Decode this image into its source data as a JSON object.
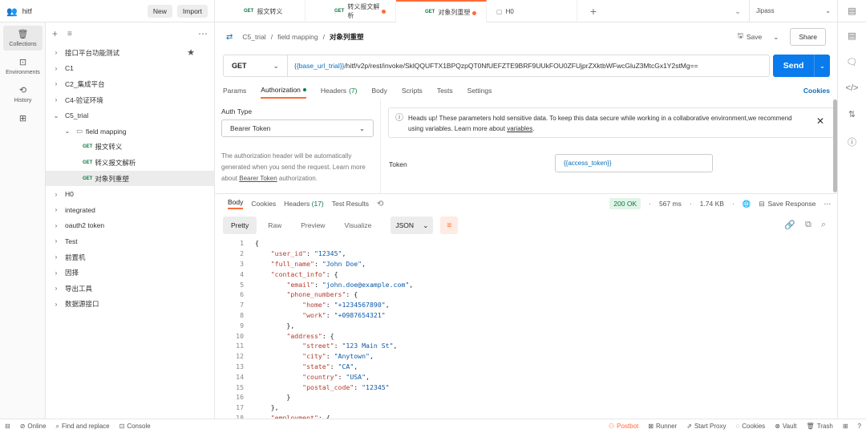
{
  "workspace": {
    "name": "hitf",
    "new": "New",
    "import": "Import"
  },
  "tabs": [
    {
      "method": "GET",
      "label": "报文转义",
      "dirty": false
    },
    {
      "method": "GET",
      "label": "转义报文解析",
      "dirty": true
    },
    {
      "method": "GET",
      "label": "对象列重塑",
      "dirty": true,
      "active": true
    },
    {
      "method": "",
      "label": "H0",
      "dirty": false
    }
  ],
  "environment": "Jipass",
  "rail": [
    {
      "label": "Collections",
      "icon": "collections-icon",
      "active": true
    },
    {
      "label": "Environments",
      "icon": "environments-icon"
    },
    {
      "label": "History",
      "icon": "history-icon"
    },
    {
      "label": "",
      "icon": "apps-icon"
    }
  ],
  "tree": [
    {
      "label": "接口平台功能测试",
      "depth": 0,
      "chev": "›",
      "star": true
    },
    {
      "label": "C1",
      "depth": 0,
      "chev": "›"
    },
    {
      "label": "C2_集成平台",
      "depth": 0,
      "chev": "›"
    },
    {
      "label": "C4-验证环境",
      "depth": 0,
      "chev": "›"
    },
    {
      "label": "C5_trial",
      "depth": 0,
      "chev": "⌄"
    },
    {
      "label": "field mapping",
      "depth": 1,
      "chev": "⌄",
      "folder": true
    },
    {
      "label": "报文转义",
      "depth": 2,
      "method": "GET"
    },
    {
      "label": "转义报文解析",
      "depth": 2,
      "method": "GET"
    },
    {
      "label": "对象列重塑",
      "depth": 2,
      "method": "GET",
      "selected": true
    },
    {
      "label": "H0",
      "depth": 0,
      "chev": "›"
    },
    {
      "label": "integrated",
      "depth": 0,
      "chev": "›"
    },
    {
      "label": "oauth2 token",
      "depth": 0,
      "chev": "›"
    },
    {
      "label": "Test",
      "depth": 0,
      "chev": "›"
    },
    {
      "label": "前置机",
      "depth": 0,
      "chev": "›"
    },
    {
      "label": "因择",
      "depth": 0,
      "chev": "›"
    },
    {
      "label": "导出工具",
      "depth": 0,
      "chev": "›"
    },
    {
      "label": "数据源接口",
      "depth": 0,
      "chev": "›"
    }
  ],
  "breadcrumb": {
    "p1": "C5_trial",
    "p2": "field mapping",
    "current": "对象列重塑",
    "save": "Save",
    "share": "Share"
  },
  "request": {
    "method": "GET",
    "url_var": "{{base_url_trial}}",
    "url_rest": " /hitf/v2p/rest/invoke/SklQQUFTX1BPQzpQT0NfUEFZTE9BRF9UUkFOU0ZFUjprZXktbWFwcGluZ3MtcGx1Y2stMg==",
    "send": "Send"
  },
  "reqtabs": {
    "params": "Params",
    "authorization": "Authorization",
    "headers": "Headers",
    "headers_count": "(7)",
    "body": "Body",
    "scripts": "Scripts",
    "tests": "Tests",
    "settings": "Settings",
    "cookies": "Cookies"
  },
  "auth": {
    "type_label": "Auth Type",
    "type_value": "Bearer Token",
    "desc1": "The authorization header will be automatically generated when you send the request. Learn more about ",
    "desc_link": "Bearer Token",
    "desc2": " authorization.",
    "warning1": "Heads up! These parameters hold sensitive data. To keep this data secure while working in a collaborative environment,we recommend using variables. Learn more about ",
    "warning_link": "variables",
    "warning2": ".",
    "token_label": "Token",
    "token_value": "{{access_token}}"
  },
  "response": {
    "tabs": {
      "body": "Body",
      "cookies": "Cookies",
      "headers": "Headers",
      "headers_count": "(17)",
      "results": "Test Results"
    },
    "status": "200 OK",
    "time": "567 ms",
    "size": "1.74 KB",
    "save": "Save Response",
    "formats": [
      "Pretty",
      "Raw",
      "Preview",
      "Visualize"
    ],
    "lang": "JSON"
  },
  "code_lines": [
    "{",
    "    \"user_id\": \"12345\",",
    "    \"full_name\": \"John Doe\",",
    "    \"contact_info\": {",
    "        \"email\": \"john.doe@example.com\",",
    "        \"phone_numbers\": {",
    "            \"home\": \"+1234567890\",",
    "            \"work\": \"+0987654321\"",
    "        },",
    "        \"address\": {",
    "            \"street\": \"123 Main St\",",
    "            \"city\": \"Anytown\",",
    "            \"state\": \"CA\",",
    "            \"country\": \"USA\",",
    "            \"postal_code\": \"12345\"",
    "        }",
    "    },",
    "    \"employment\": {"
  ],
  "statusbar": {
    "online": "Online",
    "find": "Find and replace",
    "console": "Console",
    "postbot": "Postbot",
    "runner": "Runner",
    "proxy": "Start Proxy",
    "cookies": "Cookies",
    "vault": "Vault",
    "trash": "Trash"
  }
}
